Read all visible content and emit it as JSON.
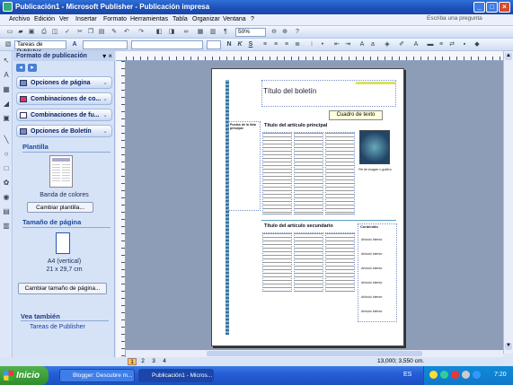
{
  "window": {
    "title": "Publicación1 - Microsoft Publisher - Publicación impresa"
  },
  "menu": [
    "Archivo",
    "Edición",
    "Ver",
    "Insertar",
    "Formato",
    "Herramientas",
    "Tabla",
    "Organizar",
    "Ventana",
    "?"
  ],
  "help_box": "Escriba una pregunta",
  "toolbar": {
    "zoom": "50%",
    "style_field": "Tareas de Publisher",
    "font_bold": "N",
    "font_italic": "K",
    "font_underline": "S"
  },
  "task_pane": {
    "title": "Formato de publicación",
    "sections": [
      "Opciones de página",
      "Combinaciones de co...",
      "Combinaciones de fu...",
      "Opciones de Boletín"
    ],
    "template_heading": "Plantilla",
    "template_name": "Banda de colores",
    "change_template": "Cambiar plantilla...",
    "page_size_heading": "Tamaño de página",
    "page_size_name": "A4 (vertical)",
    "page_size_dims": "21 x 29,7 cm",
    "change_page_size": "Cambiar tamaño de página...",
    "see_also": "Vea también",
    "see_also_link": "Tareas de Publisher"
  },
  "document": {
    "title": "Título del boletín",
    "text_box": "Cuadro de texto",
    "main_article": "Título del artículo principal",
    "secondary_article": "Título del artículo secundario",
    "sidebar_heading": "Contenido",
    "sidebar_items": [
      "Artículo interior",
      "Artículo interior",
      "Artículo interior",
      "Artículo interior",
      "Artículo interior",
      "Artículo interior"
    ],
    "left_box_heading": "Puntos de la lista principal",
    "image_caption": "Pie de imagen o gráfico"
  },
  "page_tabs": [
    "1",
    "2",
    "3",
    "4"
  ],
  "status": {
    "position": "13,000; 3,550 cm."
  },
  "taskbar": {
    "start": "Inicio",
    "tasks": [
      "Blogger: Descubre m...",
      "Publicación1 - Micros..."
    ],
    "lang": "ES",
    "clock": "7:20"
  },
  "colors": {
    "title_bar": "#1c4fb5",
    "taskbar": "#245dd6",
    "start": "#2f8d2c",
    "accent_band": "#5aa0c8"
  }
}
